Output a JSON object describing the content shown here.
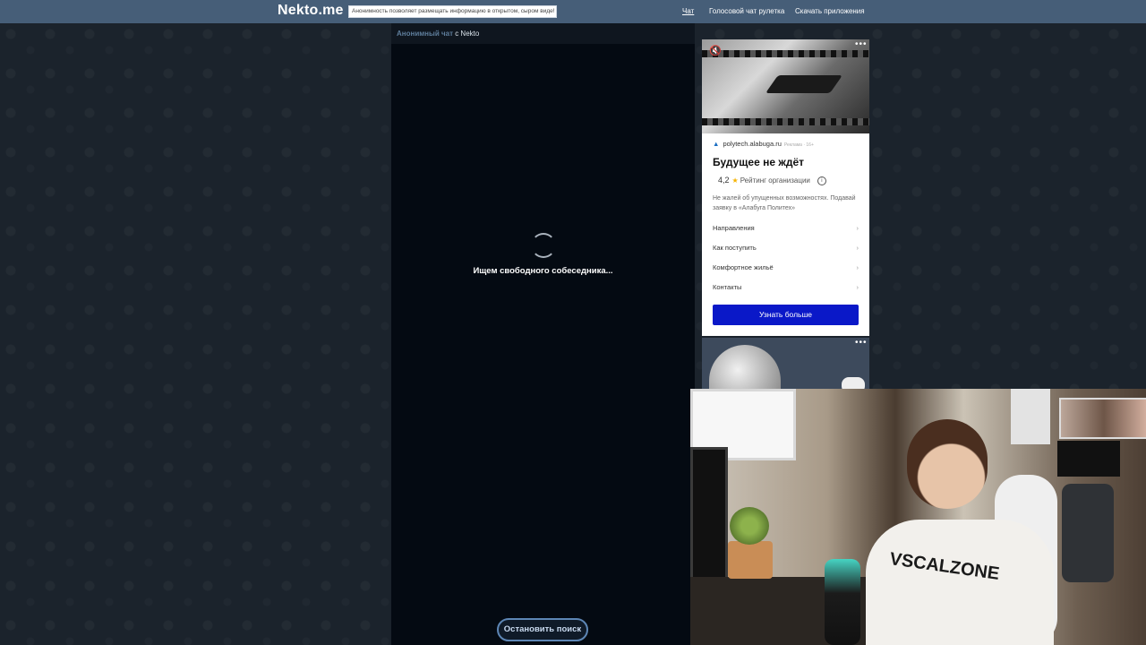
{
  "header": {
    "logo": "Nekto.me",
    "notice": "Анонимность позволяет размещать информацию в открытом, сыром виде!",
    "nav": [
      "Чат",
      "Голосовой чат рулетка",
      "Скачать приложения"
    ]
  },
  "chat": {
    "header_muted": "Анонимный чат",
    "header_plain": " с Nekto",
    "status": "Ищем свободного собеседника...",
    "stop_button": "Остановить поиск"
  },
  "ad": {
    "dots": "•••",
    "domain": "polytech.alabuga.ru",
    "domain_small": "Реклама · 16+",
    "title": "Будущее не ждёт",
    "rating": "4,2",
    "rating_label": "Рейтинг организации",
    "description": "Не жалей об упущенных возможностях. Подавай заявку в «Алабуга Политех»",
    "links": [
      "Направления",
      "Как поступить",
      "Комфортное жильё",
      "Контакты"
    ],
    "cta": "Узнать больше"
  },
  "webcam": {
    "shirt_text": "VSCALZONE"
  },
  "colors": {
    "topbar": "#465e78",
    "cta": "#0a18c8",
    "chat_bg": "#040a12"
  }
}
